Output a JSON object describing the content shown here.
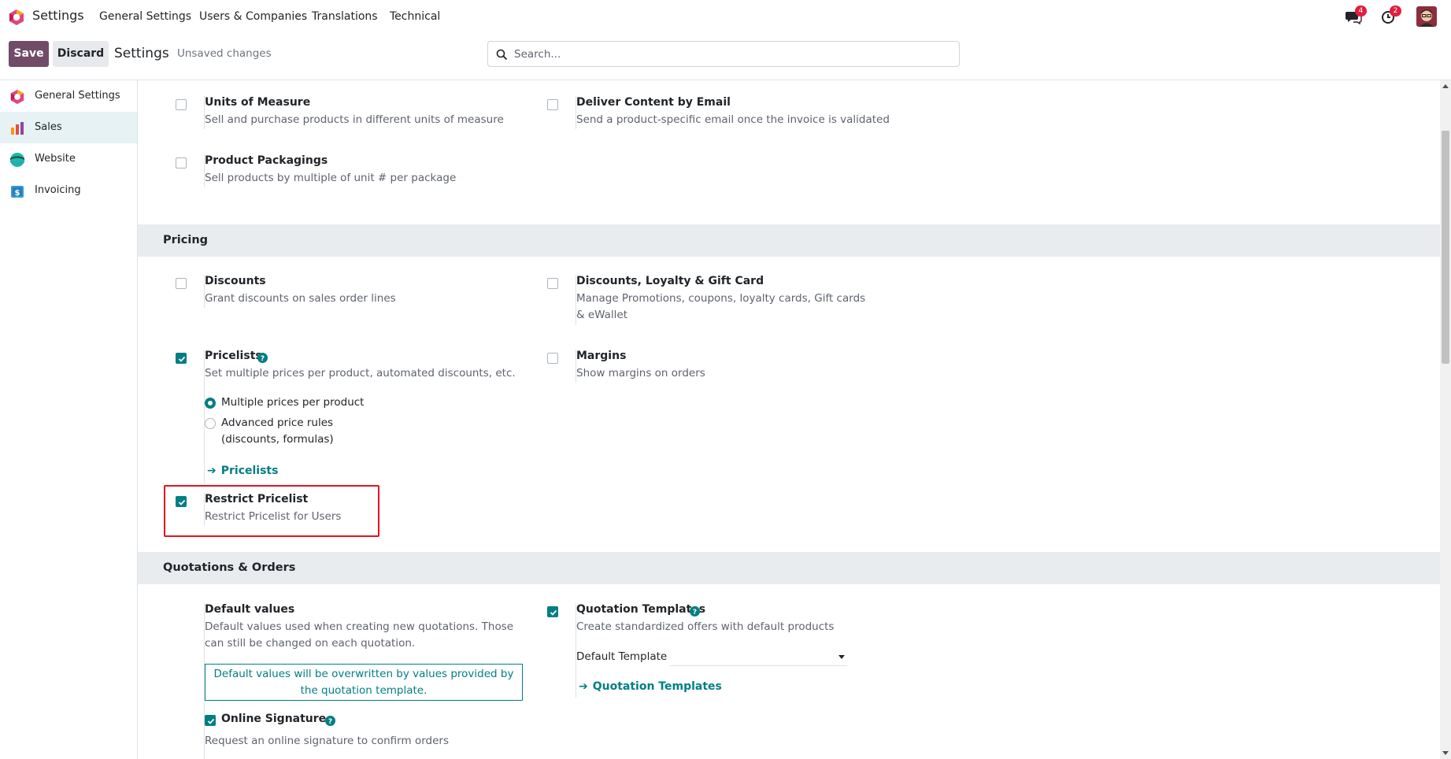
{
  "app": {
    "name": "Settings",
    "logo_icon": "odoo-logo-icon"
  },
  "top_menu": [
    "General Settings",
    "Users & Companies",
    "Translations",
    "Technical"
  ],
  "systray": {
    "messages_count": "4",
    "activities_count": "2"
  },
  "control_panel": {
    "save_label": "Save",
    "discard_label": "Discard",
    "title": "Settings",
    "status": "Unsaved changes",
    "search_placeholder": "Search..."
  },
  "sidebar": {
    "items": [
      {
        "label": "General Settings",
        "icon": "settings-app-icon"
      },
      {
        "label": "Sales",
        "icon": "sales-app-icon",
        "active": true
      },
      {
        "label": "Website",
        "icon": "website-app-icon"
      },
      {
        "label": "Invoicing",
        "icon": "invoicing-app-icon"
      }
    ]
  },
  "settings": {
    "units_of_measure": {
      "title": "Units of Measure",
      "desc": "Sell and purchase products in different units of measure",
      "checked": false
    },
    "deliver_content": {
      "title": "Deliver Content by Email",
      "desc": "Send a product-specific email once the invoice is validated",
      "checked": false
    },
    "product_packagings": {
      "title": "Product Packagings",
      "desc": "Sell products by multiple of unit # per package",
      "checked": false
    }
  },
  "pricing": {
    "heading": "Pricing",
    "discounts": {
      "title": "Discounts",
      "desc": "Grant discounts on sales order lines",
      "checked": false
    },
    "loyalty": {
      "title": "Discounts, Loyalty & Gift Card",
      "desc": "Manage Promotions, coupons, loyalty cards, Gift cards & eWallet",
      "checked": false
    },
    "pricelists": {
      "title": "Pricelists",
      "desc": "Set multiple prices per product, automated discounts, etc.",
      "checked": true,
      "option_1": "Multiple prices per product",
      "option_2": "Advanced price rules (discounts, formulas)",
      "link": "Pricelists"
    },
    "margins": {
      "title": "Margins",
      "desc": "Show margins on orders",
      "checked": false
    },
    "restrict_pricelist": {
      "title": "Restrict Pricelist",
      "desc": "Restrict Pricelist for Users",
      "checked": true
    }
  },
  "quotations": {
    "heading": "Quotations & Orders",
    "default_values": {
      "title": "Default values",
      "desc": "Default values used when creating new quotations. Those can still be changed on each quotation.",
      "info": "Default values will be overwritten by values provided by the quotation template.",
      "online_signature_label": "Online Signature",
      "online_signature_desc": "Request an online signature to confirm orders"
    },
    "templates": {
      "title": "Quotation Templates",
      "desc": "Create standardized offers with default products",
      "checked": true,
      "field_label": "Default Template",
      "field_value": "",
      "link": "Quotation Templates"
    }
  },
  "colors": {
    "brand": "#714b67",
    "accent": "#017e84",
    "highlight": "#e0141e"
  }
}
